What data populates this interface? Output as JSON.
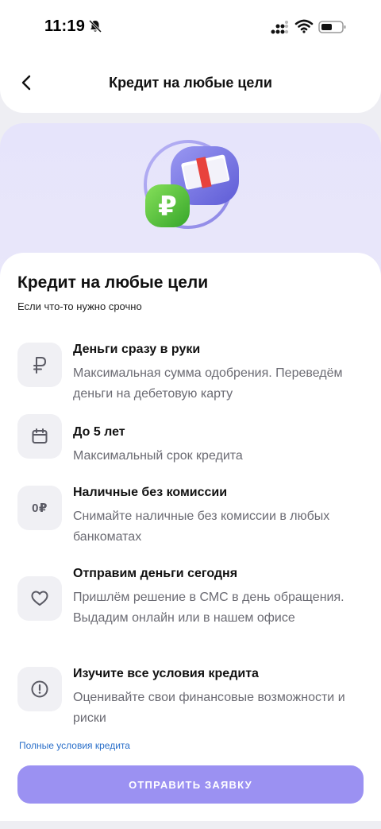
{
  "status_bar": {
    "time": "11:19",
    "icons": [
      "bell-muted-icon",
      "signal-icon",
      "wifi-icon",
      "battery-icon"
    ]
  },
  "header": {
    "back_icon": "chevron-left-icon",
    "title": "Кредит на любые цели"
  },
  "hero": {
    "illustration": "cash-and-ruble-coin-illustration",
    "colors": {
      "background": "#e6e4fb",
      "coin": "#5ac43a",
      "cash_bubble": "#7b7ce8"
    }
  },
  "main": {
    "title": "Кредит на любые цели",
    "subtitle": "Если что-то нужно срочно",
    "features": [
      {
        "icon": "ruble-icon",
        "title": "Деньги сразу в руки",
        "description": "Максимальная сумма одобрения. Переведём деньги на дебетовую карту"
      },
      {
        "icon": "calendar-icon",
        "title": "До 5 лет",
        "description": "Максимальный срок кредита"
      },
      {
        "icon": "zero-ruble-icon",
        "icon_text": "0₽",
        "title": "Наличные без комиссии",
        "description": "Снимайте наличные без комиссии в любых банкоматах"
      },
      {
        "icon": "heart-icon",
        "title": "Отправим деньги сегодня",
        "description": "Пришлём решение в СМС в день обращения. Выдадим онлайн или в нашем офисе"
      },
      {
        "icon": "exclamation-circle-icon",
        "title": "Изучите все условия кредита",
        "description": "Оценивайте свои финансовые возможности и риски"
      }
    ],
    "full_terms_link": "Полные условия кредита",
    "submit_label": "ОТПРАВИТЬ ЗАЯВКУ"
  },
  "colors": {
    "accent": "#9b91f2",
    "link": "#2a6fc9",
    "icon_tile": "#f0f0f4",
    "muted_text": "#6b6b73"
  }
}
